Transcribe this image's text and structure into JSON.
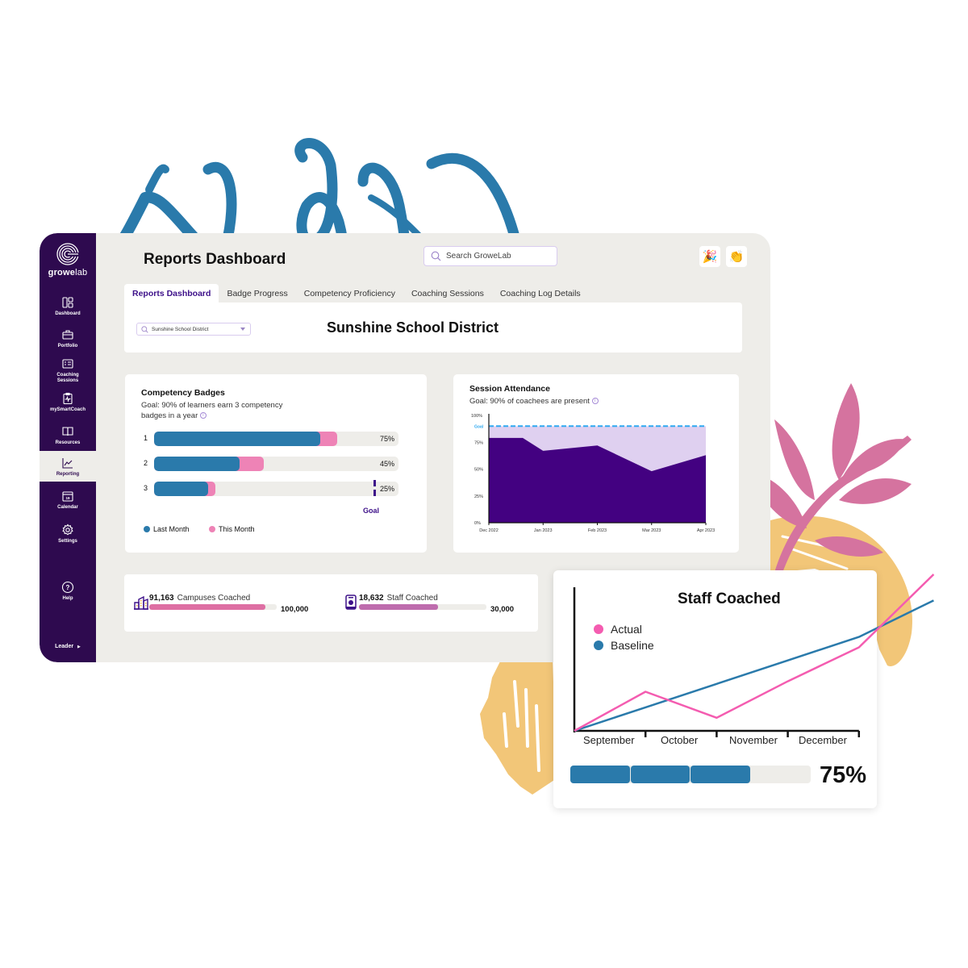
{
  "app": {
    "brand": {
      "name_bold": "growe",
      "name_light": "lab"
    },
    "page_title": "Reports Dashboard",
    "search": {
      "placeholder": "Search GroweLab"
    },
    "header_icons": [
      {
        "name": "party-popper-icon",
        "glyph": "🎉"
      },
      {
        "name": "clapping-hands-icon",
        "glyph": "👏"
      }
    ]
  },
  "sidebar": {
    "items": [
      {
        "label": "Dashboard",
        "icon": "dashboard-icon",
        "active": false
      },
      {
        "label": "Portfolio",
        "icon": "briefcase-icon",
        "active": false
      },
      {
        "label": "Coaching Sessions",
        "icon": "checklist-icon",
        "active": false
      },
      {
        "label": "mySmartCoach",
        "icon": "clipboard-pulse-icon",
        "active": false
      },
      {
        "label": "Resources",
        "icon": "book-icon",
        "active": false
      },
      {
        "label": "Reporting",
        "icon": "line-chart-icon",
        "active": true
      },
      {
        "label": "Calendar",
        "icon": "calendar-icon",
        "calendar_day": "19",
        "active": false
      },
      {
        "label": "Settings",
        "icon": "gear-icon",
        "active": false
      },
      {
        "label": "Help",
        "icon": "help-icon",
        "active": false
      }
    ],
    "role_switcher": {
      "label": "Leader",
      "icon": "caret-right-icon"
    }
  },
  "tabs": [
    {
      "label": "Reports Dashboard",
      "active": true
    },
    {
      "label": "Badge Progress",
      "active": false
    },
    {
      "label": "Competency Proficiency",
      "active": false
    },
    {
      "label": "Coaching Sessions",
      "active": false
    },
    {
      "label": "Coaching Log Details",
      "active": false
    }
  ],
  "district": {
    "select_value": "Sunshine School District",
    "title": "Sunshine School District"
  },
  "competency_badges": {
    "title": "Competency Badges",
    "subtitle_line1": "Goal: 90% of learners earn 3 competency",
    "subtitle_line2": "badges in a year",
    "goal_label": "Goal",
    "goal_pct": 90,
    "legend": {
      "last_month": "Last Month",
      "this_month": "This Month"
    },
    "colors": {
      "last_month": "#2a7aab",
      "this_month": "#ee83b6",
      "goal": "#3d1089"
    },
    "rows": [
      {
        "label": "1",
        "last_month": 68,
        "this_month": 75,
        "display": "75%"
      },
      {
        "label": "2",
        "last_month": 35,
        "this_month": 45,
        "display": "45%"
      },
      {
        "label": "3",
        "last_month": 22,
        "this_month": 25,
        "display": "25%"
      }
    ]
  },
  "session_attendance": {
    "title": "Session Attendance",
    "subtitle": "Goal: 90% of coachees are present",
    "goal_label": "Goal"
  },
  "stats": {
    "campuses": {
      "value": "91,163",
      "label": "Campuses Coached",
      "target": "100,000",
      "fraction": 0.9116,
      "color": "#de6fa3",
      "icon": "buildings-icon"
    },
    "staff": {
      "value": "18,632",
      "label": "Staff Coached",
      "target": "30,000",
      "fraction": 0.621,
      "color": "#be6cad",
      "icon": "id-badge-icon"
    }
  },
  "staff_coached": {
    "title": "Staff Coached",
    "progress_display": "75%",
    "progress_segments_filled": 3,
    "progress_segments_total": 4
  },
  "chart_data": [
    {
      "type": "area",
      "title": "Session Attendance",
      "subtitle": "Goal: 90% of coachees are present",
      "x": [
        "Dec 2022",
        "Dec 2022 (mid)",
        "Jan 2023",
        "Feb 2023",
        "Mar 2023",
        "Apr 2023"
      ],
      "x_positions": [
        0,
        0.625,
        1,
        2,
        3,
        4
      ],
      "xtick_labels": [
        "Dec 2022",
        "Jan 2023",
        "Feb 2023",
        "Mar 2023",
        "Apr 2023"
      ],
      "series": [
        {
          "name": "Attendance",
          "values": [
            79,
            79,
            67,
            72,
            48,
            63
          ],
          "color": "#430181"
        }
      ],
      "goal": {
        "label": "Goal",
        "value": 90,
        "color": "#2fa9f0",
        "gap_fill": "#dfd0f0"
      },
      "ytick_labels": [
        "0%",
        "25%",
        "50%",
        "75%",
        "100%"
      ],
      "ylim": [
        0,
        100
      ],
      "grid": false
    },
    {
      "type": "line",
      "title": "Staff Coached",
      "categories": [
        "September",
        "October",
        "November",
        "December"
      ],
      "x_positions": [
        0,
        1,
        2,
        3,
        4,
        5.05
      ],
      "series": [
        {
          "name": "Actual",
          "color": "#f45cb0",
          "values": [
            0,
            15,
            5,
            19,
            32,
            60
          ]
        },
        {
          "name": "Baseline",
          "color": "#2a7aab",
          "values": [
            0,
            9,
            18,
            27,
            36,
            50
          ]
        }
      ],
      "legend": "top-left",
      "xlabel": "",
      "ylabel": "",
      "ylim": [
        0,
        60
      ]
    }
  ]
}
